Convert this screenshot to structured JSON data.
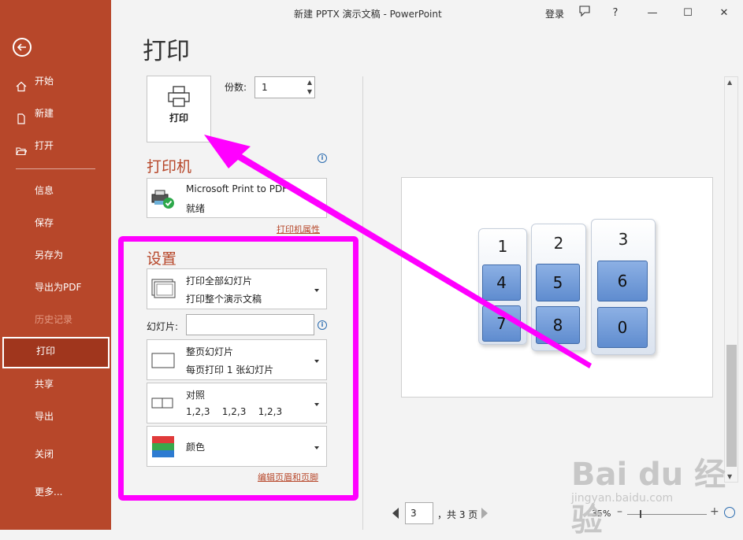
{
  "window": {
    "title": "新建 PPTX 演示文稿  -  PowerPoint",
    "login": "登录",
    "help": "?",
    "minimize": "—",
    "maximize": "☐",
    "close": "✕"
  },
  "nav": {
    "items": [
      {
        "label": "开始",
        "icon": "home-icon"
      },
      {
        "label": "新建",
        "icon": "new-file-icon"
      },
      {
        "label": "打开",
        "icon": "folder-open-icon"
      },
      {
        "label": "信息"
      },
      {
        "label": "保存"
      },
      {
        "label": "另存为"
      },
      {
        "label": "导出为PDF"
      },
      {
        "label": "历史记录",
        "state": "disabled"
      },
      {
        "label": "打印",
        "state": "active"
      },
      {
        "label": "共享"
      },
      {
        "label": "导出"
      },
      {
        "label": "关闭"
      },
      {
        "label": "更多..."
      }
    ]
  },
  "print": {
    "heading": "打印",
    "print_button": "打印",
    "copies_label": "份数:",
    "copies_value": "1",
    "printer_heading": "打印机",
    "printer_name": "Microsoft Print to PDF",
    "printer_status": "就绪",
    "printer_props_link": "打印机属性",
    "settings_heading": "设置",
    "range_line1": "打印全部幻灯片",
    "range_line2": "打印整个演示文稿",
    "slides_label": "幻灯片:",
    "slides_value": "",
    "layout_line1": "整页幻灯片",
    "layout_line2": "每页打印 1 张幻灯片",
    "collate_line1": "对照",
    "collate_line2": "1,2,3    1,2,3    1,2,3",
    "color_line1": "颜色",
    "header_footer_link": "编辑页眉和页脚"
  },
  "preview": {
    "card_numbers": [
      "1",
      "2",
      "3"
    ],
    "keys": [
      "4",
      "5",
      "6",
      "7",
      "8",
      "0"
    ],
    "page_current": "3",
    "page_total": "，共 3 页",
    "zoom": "35%",
    "zoom_minus": "–",
    "zoom_plus": "+"
  },
  "watermark": {
    "line1": "Bai du 经验",
    "line2": "jingyan.baidu.com"
  },
  "colors": {
    "accent": "#b7472a",
    "annotation": "#ff00ff"
  }
}
